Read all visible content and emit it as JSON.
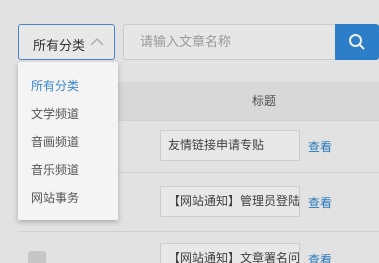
{
  "filter": {
    "category_selected": "所有分类",
    "search_placeholder": "请输入文章名称"
  },
  "dropdown": {
    "items": [
      {
        "label": "所有分类",
        "selected": true
      },
      {
        "label": "文学频道",
        "selected": false
      },
      {
        "label": "音画频道",
        "selected": false
      },
      {
        "label": "音乐频道",
        "selected": false
      },
      {
        "label": "网站事务",
        "selected": false
      }
    ]
  },
  "table": {
    "columns": {
      "title": "标题"
    },
    "rows": [
      {
        "title": "友情链接申请专贴",
        "action": "查看"
      },
      {
        "title": "【网站通知】管理员登陆",
        "action": "查看"
      },
      {
        "title": "【网站通知】文章署名问",
        "action": "查看"
      }
    ]
  },
  "colors": {
    "accent": "#2f86d6",
    "link": "#2c80c9",
    "selected_item": "#3a86cf"
  },
  "icons": {
    "select_arrow": "chevron-up-icon",
    "search": "search-icon"
  }
}
